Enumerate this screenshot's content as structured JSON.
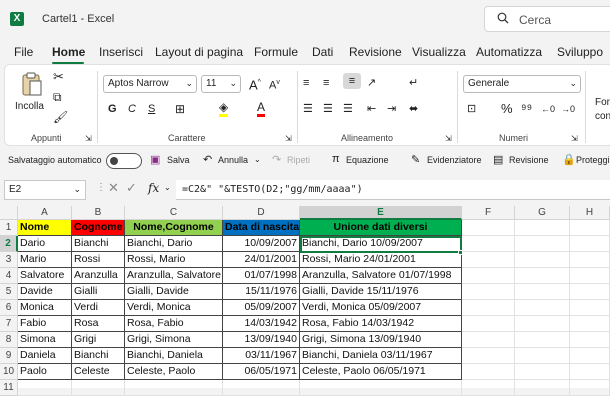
{
  "title": "Cartel1 - Excel",
  "search": {
    "placeholder": "Cerca"
  },
  "menu_tabs": [
    "File",
    "Home",
    "Inserisci",
    "Layout di pagina",
    "Formule",
    "Dati",
    "Revisione",
    "Visualizza",
    "Automatizza",
    "Sviluppo"
  ],
  "ribbon": {
    "paste_label": "Incolla",
    "font_name": "Aptos Narrow",
    "font_size": "11",
    "bold": "G",
    "italic": "C",
    "underline": "S",
    "number_format": "Generale",
    "groups": {
      "clipboard": "Appunti",
      "font": "Carattere",
      "alignment": "Allineamento",
      "number": "Numeri"
    },
    "format_partial_1": "For",
    "format_partial_2": "con"
  },
  "quick_access": {
    "autosave": "Salvataggio automatico",
    "save": "Salva",
    "undo": "Annulla",
    "redo": "Ripeti",
    "equation": "Equazione",
    "highlighter": "Evidenziatore",
    "review": "Revisione",
    "protect": "Proteggi"
  },
  "formula_bar": {
    "name_box": "E2",
    "formula": "=C2&\" \"&TESTO(D2;\"gg/mm/aaaa\")"
  },
  "columns": [
    "A",
    "B",
    "C",
    "D",
    "E",
    "F",
    "G",
    "H"
  ],
  "rows": [
    "1",
    "2",
    "3",
    "4",
    "5",
    "6",
    "7",
    "8",
    "9",
    "10",
    "11"
  ],
  "headers": [
    "Nome",
    "Cognome",
    "Nome,Cognome",
    "Data di nascita",
    "Unione dati diversi"
  ],
  "header_colors": [
    "#ffff00",
    "#ff0000",
    "#92d050",
    "#0070c0",
    "#00b050"
  ],
  "data": [
    [
      "Dario",
      "Bianchi",
      "Bianchi, Dario",
      "10/09/2007",
      "Bianchi, Dario 10/09/2007"
    ],
    [
      "Mario",
      "Rossi",
      "Rossi, Mario",
      "24/01/2001",
      "Rossi, Mario 24/01/2001"
    ],
    [
      "Salvatore",
      "Aranzulla",
      "Aranzulla, Salvatore",
      "01/07/1998",
      "Aranzulla, Salvatore 01/07/1998"
    ],
    [
      "Davide",
      "Gialli",
      "Gialli, Davide",
      "15/11/1976",
      "Gialli, Davide 15/11/1976"
    ],
    [
      "Monica",
      "Verdi",
      "Verdi, Monica",
      "05/09/2007",
      "Verdi, Monica 05/09/2007"
    ],
    [
      "Fabio",
      "Rosa",
      "Rosa, Fabio",
      "14/03/1942",
      "Rosa, Fabio 14/03/1942"
    ],
    [
      "Simona",
      "Grigi",
      "Grigi, Simona",
      "13/09/1940",
      "Grigi, Simona 13/09/1940"
    ],
    [
      "Daniela",
      "Bianchi",
      "Bianchi, Daniela",
      "03/11/1967",
      "Bianchi, Daniela 03/11/1967"
    ],
    [
      "Paolo",
      "Celeste",
      "Celeste, Paolo",
      "06/05/1971",
      "Celeste, Paolo 06/05/1971"
    ]
  ]
}
